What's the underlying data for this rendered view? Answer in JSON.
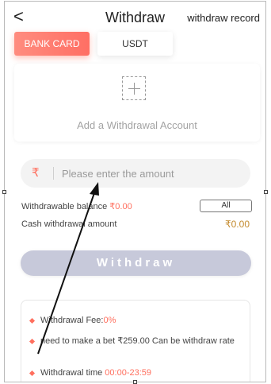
{
  "header": {
    "back_icon": "chevron-left-icon",
    "back_glyph": "<",
    "title": "Withdraw",
    "record_link": "withdraw record"
  },
  "tabs": [
    {
      "label": "BANK CARD",
      "active": true
    },
    {
      "label": "USDT",
      "active": false
    }
  ],
  "add_account": {
    "icon": "plus-icon",
    "label": "Add a Withdrawal Account"
  },
  "amount_input": {
    "currency_symbol": "₹",
    "placeholder": "Please enter the amount",
    "value": ""
  },
  "balances": {
    "withdrawable_label": "Withdrawable balance",
    "withdrawable_value": "₹0.00",
    "all_button": "All",
    "cash_label": "Cash withdrawal amount",
    "cash_value": "₹0.00"
  },
  "withdraw_button": "Withdraw",
  "notes": [
    {
      "prefix": "Withdrawal Fee:",
      "highlight": "0%"
    },
    {
      "prefix": "need to make a bet ₹259.00 Can be withdraw rate",
      "highlight": ""
    },
    {
      "prefix": "Withdrawal time ",
      "highlight": "00:00-23:59"
    }
  ],
  "colors": {
    "accent": "#ff6f5e",
    "tab_gradient_start": "#ff8c7f",
    "tab_gradient_end": "#ff6f64",
    "button_disabled": "#c7c9da",
    "gold_amount": "#c48b2f"
  }
}
